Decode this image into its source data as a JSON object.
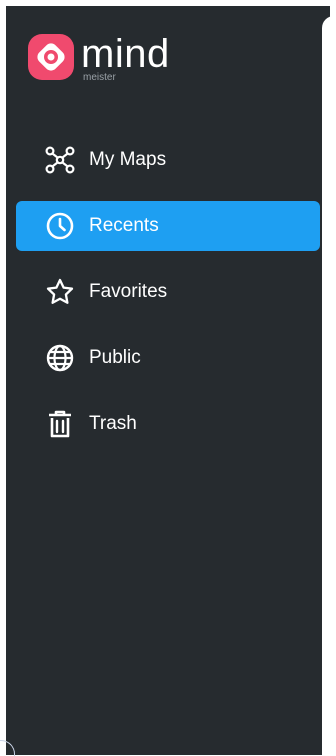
{
  "brand": {
    "name": "mind",
    "sub": "meister",
    "logo_color": "#f04a6e"
  },
  "nav": {
    "items": [
      {
        "label": "My Maps",
        "icon": "map-network-icon",
        "active": false
      },
      {
        "label": "Recents",
        "icon": "clock-icon",
        "active": true
      },
      {
        "label": "Favorites",
        "icon": "star-icon",
        "active": false
      },
      {
        "label": "Public",
        "icon": "globe-icon",
        "active": false
      },
      {
        "label": "Trash",
        "icon": "trash-icon",
        "active": false
      }
    ]
  },
  "colors": {
    "sidebar_bg": "#262b2f",
    "active_bg": "#1e9ff2",
    "text": "#ffffff"
  }
}
